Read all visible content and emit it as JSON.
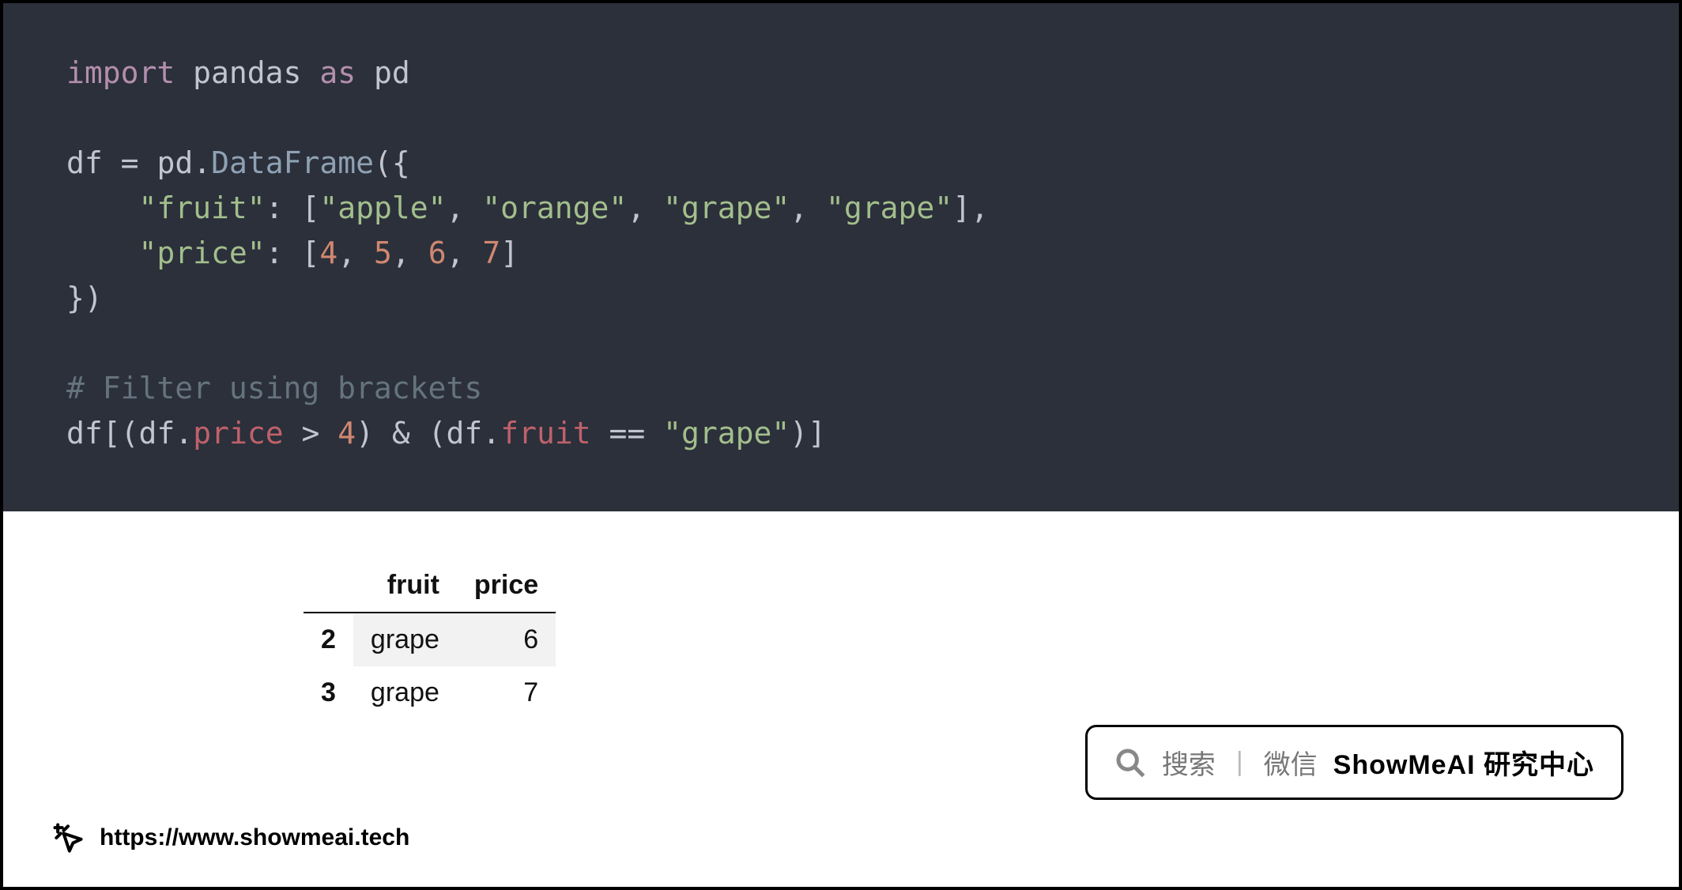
{
  "code": {
    "import_kw": "import",
    "module": "pandas",
    "as_kw": "as",
    "alias": "pd",
    "var_df": "df",
    "eq": "=",
    "pd": "pd",
    "dot": ".",
    "ctor": "DataFrame",
    "open_paren_brace": "({",
    "key_fruit": "\"fruit\"",
    "colon1": ":",
    "lb1": "[",
    "fruit_apple": "\"apple\"",
    "comma": ",",
    "fruit_orange": "\"orange\"",
    "fruit_grape1": "\"grape\"",
    "fruit_grape2": "\"grape\"",
    "rb1": "],",
    "key_price": "\"price\"",
    "colon2": ":",
    "lb2": "[",
    "n4": "4",
    "n5": "5",
    "n6": "6",
    "n7": "7",
    "rb2": "]",
    "close_brace_paren": "})",
    "comment": "# Filter using brackets",
    "filter": {
      "df1": "df",
      "lb": "[(",
      "df2": "df",
      "attr_price": "price",
      "gt": ">",
      "four": "4",
      "amp": ") & (",
      "df3": "df",
      "attr_fruit": "fruit",
      "eqop": "==",
      "grape": "\"grape\"",
      "rb": ")]"
    }
  },
  "table": {
    "headers": {
      "idx": "",
      "fruit": "fruit",
      "price": "price"
    },
    "rows": [
      {
        "idx": "2",
        "fruit": "grape",
        "price": "6"
      },
      {
        "idx": "3",
        "fruit": "grape",
        "price": "7"
      }
    ]
  },
  "footer": {
    "url": "https://www.showmeai.tech"
  },
  "badge": {
    "search": "搜索",
    "wechat": "微信",
    "brand": "ShowMeAI 研究中心"
  }
}
